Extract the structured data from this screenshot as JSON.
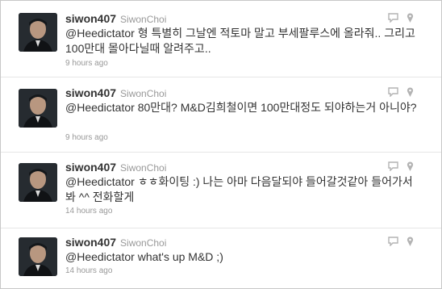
{
  "tweets": [
    {
      "screen_name": "siwon407",
      "full_name": "SiwonChoi",
      "mention": "@Heedictator",
      "body": " 형 특별히 그날엔 적토마 말고 부세팔루스에 올라줘.. 그리고 100만대 몰아다닐때 알려주고..",
      "time": "9 hours ago"
    },
    {
      "screen_name": "siwon407",
      "full_name": "SiwonChoi",
      "mention": "@Heedictator",
      "body": " 80만대? M&D김희철이면 100만대정도 되야하는거 아니야?",
      "time": "9 hours ago"
    },
    {
      "screen_name": "siwon407",
      "full_name": "SiwonChoi",
      "mention": "@Heedictator",
      "body": " ㅎㅎ화이팅 :) 나는 아마 다음달되야 들어갈것같아 들어가서봐 ^^ 전화할게",
      "time": "14 hours ago"
    },
    {
      "screen_name": "siwon407",
      "full_name": "SiwonChoi",
      "mention": "@Heedictator",
      "body": " what's up M&D ;)",
      "time": "14 hours ago"
    }
  ],
  "icons": {
    "reply": "reply-bubble-icon",
    "location": "location-pin-icon",
    "icon_color": "#b3b3b3"
  }
}
